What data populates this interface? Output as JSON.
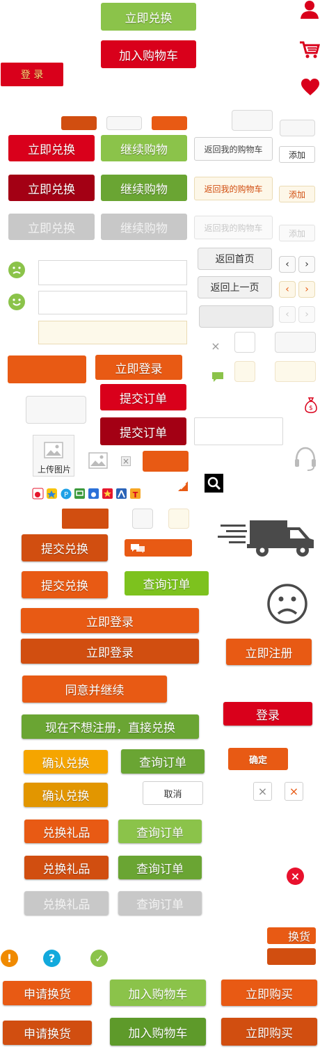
{
  "colors": {
    "green": "#8bc34a",
    "red": "#d9001b",
    "dark_red": "#a30014",
    "orange": "#e85a14",
    "dark_orange": "#d14e10",
    "amber": "#f5a500",
    "grey": "#c8c8c8",
    "lime": "#7dc21e"
  },
  "icons": {
    "user": "user-icon",
    "cart": "cart-icon",
    "heart": "heart-icon",
    "sad_face": "sad-face-icon",
    "happy_face": "smile-face-icon",
    "close": "close-icon",
    "chat": "chat-bubble-icon",
    "money_bag": "money-bag-icon",
    "image": "image-placeholder-icon",
    "headset": "headset-icon",
    "search": "search-icon",
    "truck": "delivery-truck-icon",
    "warning": "warning-icon",
    "help": "help-icon",
    "check": "check-icon",
    "error": "error-x-icon"
  },
  "buttons": {
    "redeem_now_top": "立即兑换",
    "add_to_cart_top": "加入购物车",
    "login_small": "登 录",
    "redeem_now": "立即兑换",
    "continue_shopping": "继续购物",
    "back_to_cart": "返回我的购物车",
    "add": "添加",
    "back_home": "返回首页",
    "back_prev": "返回上一页",
    "login_now": "立即登录",
    "submit_order": "提交订单",
    "upload_image": "上传图片",
    "submit_redeem": "提交兑换",
    "query_order": "查询订单",
    "register_now": "立即注册",
    "agree_continue": "同意并继续",
    "skip_register": "现在不想注册，直接兑换",
    "login": "登录",
    "confirm_redeem": "确认兑换",
    "confirm": "确定",
    "cancel": "取消",
    "redeem_gift": "兑换礼品",
    "exchange": "换货",
    "apply_exchange": "申请换货",
    "add_to_cart": "加入购物车",
    "buy_now": "立即购买"
  },
  "glyphs": {
    "prev": "‹",
    "next": "›",
    "close": "×",
    "warning": "!",
    "help": "?",
    "check": "✓"
  },
  "share_icons": [
    "sina-weibo-icon",
    "qzone-icon",
    "qq-icon",
    "douban-icon",
    "baidu-icon",
    "star-icon",
    "renren-icon",
    "tencent-icon"
  ]
}
